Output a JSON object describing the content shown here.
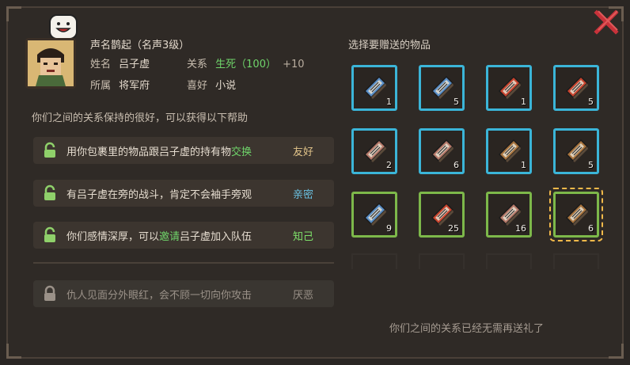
{
  "character": {
    "fame": "声名鹊起（名声3级）",
    "name_label": "姓名",
    "name": "吕子虚",
    "relation_label": "关系",
    "relation_value": "生死（100）",
    "relation_bonus": "+10",
    "faction_label": "所属",
    "faction": "将军府",
    "hobby_label": "喜好",
    "hobby": "小说"
  },
  "help_text": "你们之间的关系保持的很好，可以获得以下帮助",
  "benefits": [
    {
      "pre": "用你包裹里的物品跟吕子虚的持有物",
      "hl": "交换",
      "post": "",
      "tier": "友好"
    },
    {
      "pre": "有吕子虚在旁的战斗，肯定不会袖手旁观",
      "hl": "",
      "post": "",
      "tier": "亲密"
    },
    {
      "pre": "你们感情深厚，可以",
      "hl": "邀请",
      "post": "吕子虚加入队伍",
      "tier": "知己"
    },
    {
      "pre": "仇人见面分外眼红，会不顾一切向你攻击",
      "hl": "",
      "post": "",
      "tier": "厌恶"
    }
  ],
  "items_title": "选择要赠送的物品",
  "items": [
    {
      "count": "1",
      "color": "#5a8fc8",
      "frame": "blue"
    },
    {
      "count": "5",
      "color": "#5a8fc8",
      "frame": "blue"
    },
    {
      "count": "1",
      "color": "#c8442e",
      "frame": "blue"
    },
    {
      "count": "5",
      "color": "#c8442e",
      "frame": "blue"
    },
    {
      "count": "2",
      "color": "#b67a6a",
      "frame": "blue"
    },
    {
      "count": "6",
      "color": "#b67a6a",
      "frame": "blue"
    },
    {
      "count": "1",
      "color": "#a8743e",
      "frame": "blue"
    },
    {
      "count": "5",
      "color": "#a8743e",
      "frame": "blue"
    },
    {
      "count": "9",
      "color": "#5a8fc8",
      "frame": "green"
    },
    {
      "count": "25",
      "color": "#c8442e",
      "frame": "green"
    },
    {
      "count": "16",
      "color": "#b67a6a",
      "frame": "green"
    },
    {
      "count": "6",
      "color": "#a8743e",
      "frame": "green",
      "selected": true
    }
  ],
  "footer_text": "你们之间的关系已经无需再送礼了",
  "colors": {
    "accent_blue": "#3bb5d8",
    "accent_green": "#7db84a",
    "positive_text": "#6fd46a",
    "close_red": "#c8323a"
  }
}
